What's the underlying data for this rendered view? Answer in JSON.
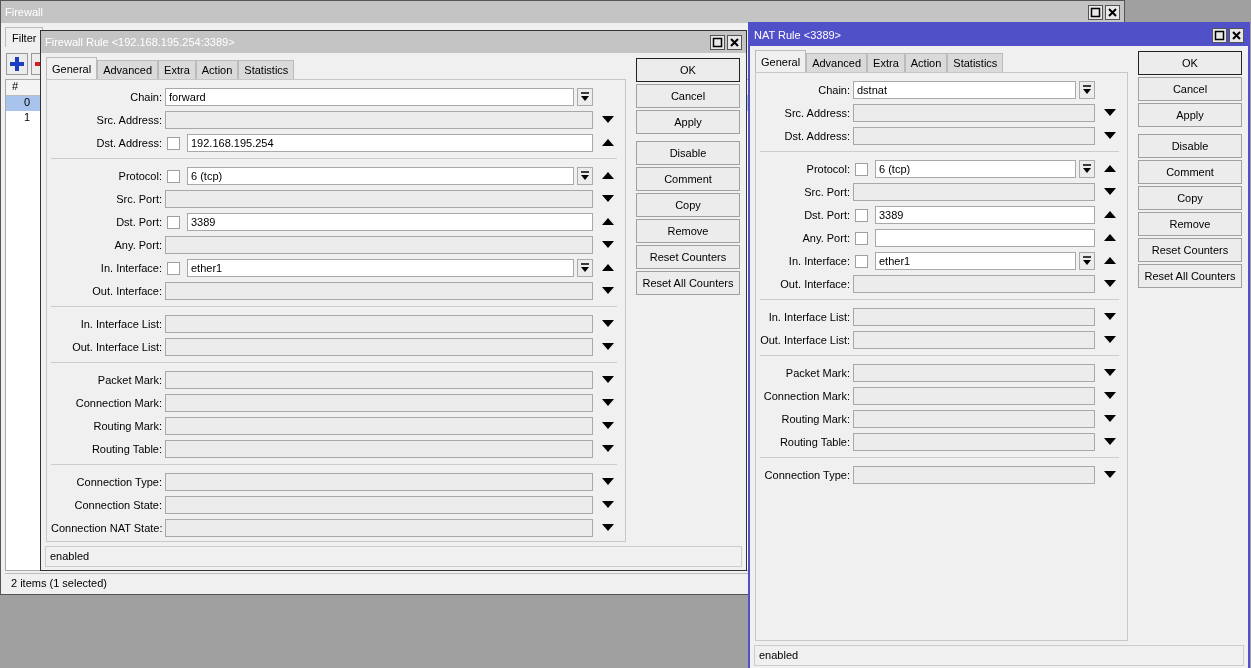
{
  "background_window": {
    "title": "Firewall",
    "tabs": [
      {
        "label": "Filter",
        "selected": true
      }
    ],
    "list": {
      "columns": [
        "#"
      ],
      "rows": [
        {
          "cells": [
            "0"
          ],
          "selected": true
        },
        {
          "cells": [
            "1"
          ],
          "selected": false
        }
      ]
    },
    "status_bar": "2 items (1 selected)"
  },
  "dialogs": [
    {
      "title": "Firewall Rule <192.168.195.254:3389>",
      "active": false,
      "tabs": [
        {
          "label": "General",
          "selected": true
        },
        {
          "label": "Advanced",
          "selected": false
        },
        {
          "label": "Extra",
          "selected": false
        },
        {
          "label": "Action",
          "selected": false
        },
        {
          "label": "Statistics",
          "selected": false
        }
      ],
      "sections": [
        [
          {
            "label": "Chain:",
            "kind": "select",
            "value": "forward"
          },
          {
            "label": "Src. Address:",
            "kind": "empty"
          },
          {
            "label": "Dst. Address:",
            "kind": "negatable",
            "checked": false,
            "value": "192.168.195.254",
            "dropdown": false
          }
        ],
        [
          {
            "label": "Protocol:",
            "kind": "negatable",
            "checked": false,
            "value": "6 (tcp)",
            "dropdown": true
          },
          {
            "label": "Src. Port:",
            "kind": "empty"
          },
          {
            "label": "Dst. Port:",
            "kind": "negatable",
            "checked": false,
            "value": "3389",
            "dropdown": false
          },
          {
            "label": "Any. Port:",
            "kind": "empty"
          },
          {
            "label": "In. Interface:",
            "kind": "negatable",
            "checked": false,
            "value": "ether1",
            "dropdown": true
          },
          {
            "label": "Out. Interface:",
            "kind": "empty"
          }
        ],
        [
          {
            "label": "In. Interface List:",
            "kind": "empty"
          },
          {
            "label": "Out. Interface List:",
            "kind": "empty"
          }
        ],
        [
          {
            "label": "Packet Mark:",
            "kind": "empty"
          },
          {
            "label": "Connection Mark:",
            "kind": "empty"
          },
          {
            "label": "Routing Mark:",
            "kind": "empty"
          },
          {
            "label": "Routing Table:",
            "kind": "empty"
          }
        ],
        [
          {
            "label": "Connection Type:",
            "kind": "empty"
          },
          {
            "label": "Connection State:",
            "kind": "empty"
          },
          {
            "label": "Connection NAT State:",
            "kind": "empty"
          }
        ]
      ],
      "buttons": [
        {
          "label": "OK",
          "default": true
        },
        {
          "label": "Cancel",
          "default": false
        },
        {
          "label": "Apply",
          "default": false
        },
        {
          "label": "Disable",
          "default": false
        },
        {
          "label": "Comment",
          "default": false
        },
        {
          "label": "Copy",
          "default": false
        },
        {
          "label": "Remove",
          "default": false
        },
        {
          "label": "Reset Counters",
          "default": false
        },
        {
          "label": "Reset All Counters",
          "default": false
        }
      ],
      "status": "enabled"
    },
    {
      "title": "NAT Rule <3389>",
      "active": true,
      "tabs": [
        {
          "label": "General",
          "selected": true
        },
        {
          "label": "Advanced",
          "selected": false
        },
        {
          "label": "Extra",
          "selected": false
        },
        {
          "label": "Action",
          "selected": false
        },
        {
          "label": "Statistics",
          "selected": false
        }
      ],
      "sections": [
        [
          {
            "label": "Chain:",
            "kind": "select",
            "value": "dstnat"
          },
          {
            "label": "Src. Address:",
            "kind": "empty"
          },
          {
            "label": "Dst. Address:",
            "kind": "empty"
          }
        ],
        [
          {
            "label": "Protocol:",
            "kind": "negatable",
            "checked": false,
            "value": "6 (tcp)",
            "dropdown": true
          },
          {
            "label": "Src. Port:",
            "kind": "empty"
          },
          {
            "label": "Dst. Port:",
            "kind": "negatable",
            "checked": false,
            "value": "3389",
            "dropdown": false
          },
          {
            "label": "Any. Port:",
            "kind": "negatable",
            "checked": false,
            "dropdown": false
          },
          {
            "label": "In. Interface:",
            "kind": "negatable",
            "checked": false,
            "value": "ether1",
            "dropdown": true
          },
          {
            "label": "Out. Interface:",
            "kind": "empty"
          }
        ],
        [
          {
            "label": "In. Interface List:",
            "kind": "empty"
          },
          {
            "label": "Out. Interface List:",
            "kind": "empty"
          }
        ],
        [
          {
            "label": "Packet Mark:",
            "kind": "empty"
          },
          {
            "label": "Connection Mark:",
            "kind": "empty"
          },
          {
            "label": "Routing Mark:",
            "kind": "empty"
          },
          {
            "label": "Routing Table:",
            "kind": "empty"
          }
        ],
        [
          {
            "label": "Connection Type:",
            "kind": "empty"
          }
        ]
      ],
      "buttons": [
        {
          "label": "OK",
          "default": true
        },
        {
          "label": "Cancel",
          "default": false
        },
        {
          "label": "Apply",
          "default": false
        },
        {
          "label": "Disable",
          "default": false
        },
        {
          "label": "Comment",
          "default": false
        },
        {
          "label": "Copy",
          "default": false
        },
        {
          "label": "Remove",
          "default": false
        },
        {
          "label": "Reset Counters",
          "default": false
        },
        {
          "label": "Reset All Counters",
          "default": false
        }
      ],
      "status": "enabled"
    }
  ]
}
